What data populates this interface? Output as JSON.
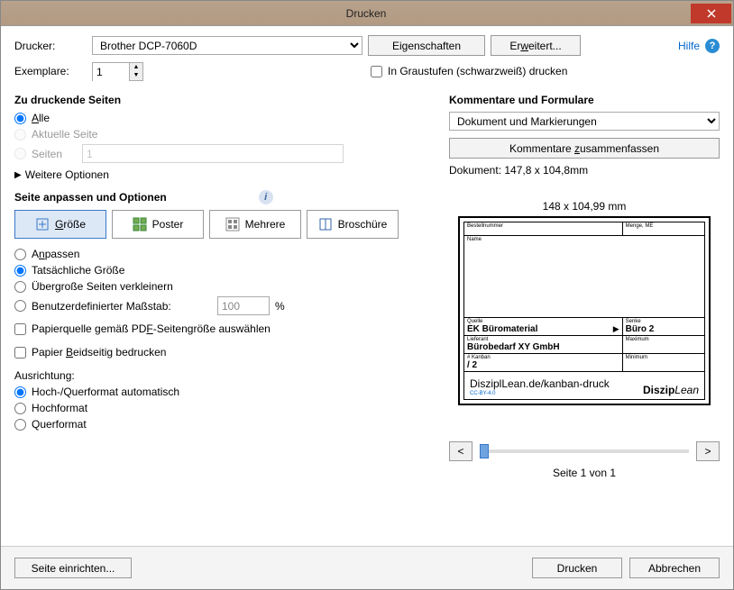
{
  "window": {
    "title": "Drucken"
  },
  "toolbar": {
    "printer_label": "Drucker:",
    "printer_value": "Brother DCP-7060D",
    "properties_btn": "Eigenschaften",
    "advanced_btn": "Erweitert...",
    "help_link": "Hilfe",
    "copies_label": "Exemplare:",
    "copies_value": "1",
    "grayscale_label": "In Graustufen (schwarzweiß) drucken"
  },
  "pages": {
    "title": "Zu druckende Seiten",
    "all": "Alle",
    "current": "Aktuelle Seite",
    "pages_label": "Seiten",
    "pages_value": "1",
    "more": "Weitere Optionen"
  },
  "size_opts": {
    "title": "Seite anpassen und Optionen",
    "tab_size": "Größe",
    "tab_poster": "Poster",
    "tab_multi": "Mehrere",
    "tab_booklet": "Broschüre",
    "fit": "Anpassen",
    "actual": "Tatsächliche Größe",
    "shrink": "Übergroße Seiten verkleinern",
    "custom": "Benutzerdefinierter Maßstab:",
    "custom_value": "100",
    "custom_unit": "%",
    "paper_source": "Papierquelle gemäß PDF-Seitengröße auswählen",
    "duplex": "Papier Beidseitig bedrucken"
  },
  "orientation": {
    "title": "Ausrichtung:",
    "auto": "Hoch-/Querformat automatisch",
    "portrait": "Hochformat",
    "landscape": "Querformat"
  },
  "comments": {
    "title": "Kommentare und Formulare",
    "select_value": "Dokument und Markierungen",
    "summarize": "Kommentare zusammenfassen"
  },
  "preview": {
    "doc_size": "Dokument: 147,8 x 104,8mm",
    "page_size": "148 x 104,99 mm",
    "fields": {
      "bestellnummer": "Bestellnummer",
      "menge": "Menge, ME",
      "name": "Name",
      "quelle_lbl": "Quelle",
      "quelle_val": "EK Büromaterial",
      "senke_lbl": "Senke",
      "senke_val": "Büro 2",
      "lieferant_lbl": "Lieferant",
      "lieferant_val": "Bürobedarf XY GmbH",
      "maximum_lbl": "Maximum",
      "maximum_val": "",
      "kanban_lbl": "# Kanban",
      "kanban_val": "  / 2",
      "minimum_lbl": "Minimum",
      "minimum_val": "",
      "url": "DisziplLean.de/kanban-druck",
      "cc": "CC-BY-4.0",
      "brand1": "Diszip",
      "brand2": "Lean"
    },
    "nav_page": "Seite 1 von 1",
    "prev": "<",
    "next": ">"
  },
  "footer": {
    "page_setup": "Seite einrichten...",
    "print": "Drucken",
    "cancel": "Abbrechen"
  }
}
